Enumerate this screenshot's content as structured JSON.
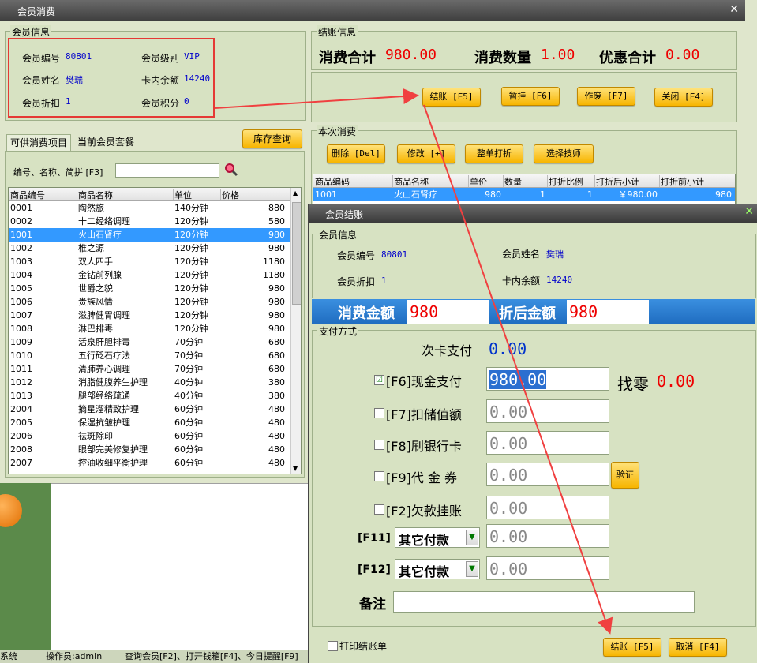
{
  "window": {
    "title": "会员消费"
  },
  "member_info": {
    "title": "会员信息",
    "no_label": "会员编号",
    "no": "80801",
    "level_label": "会员级别",
    "level": "VIP",
    "name_label": "会员姓名",
    "name": "樊瑞",
    "balance_label": "卡内余额",
    "balance": "14240",
    "discount_label": "会员折扣",
    "discount": "1",
    "points_label": "会员积分",
    "points": "0"
  },
  "checkout_info": {
    "title": "结账信息",
    "total_label": "消费合计",
    "total": "980.00",
    "qty_label": "消费数量",
    "qty": "1.00",
    "discount_label": "优惠合计",
    "discount": "0.00",
    "buttons": [
      "结账 [F5]",
      "暂挂 [F6]",
      "作废 [F7]",
      "关闭 [F4]"
    ]
  },
  "tabs": {
    "items": "可供消费项目",
    "packages": "当前会员套餐",
    "stock_button": "库存查询"
  },
  "search": {
    "label": "编号、名称、简拼 [F3]",
    "value": ""
  },
  "product_table": {
    "columns": [
      "商品编号",
      "商品名称",
      "单位",
      "价格"
    ],
    "selected_index": 2,
    "rows": [
      [
        "0001",
        "陶然旅",
        "140分钟",
        "880"
      ],
      [
        "0002",
        "十二经络调理",
        "120分钟",
        "580"
      ],
      [
        "1001",
        "火山石肾疗",
        "120分钟",
        "980"
      ],
      [
        "1002",
        "椎之源",
        "120分钟",
        "980"
      ],
      [
        "1003",
        "双人四手",
        "120分钟",
        "1180"
      ],
      [
        "1004",
        "金钻前列腺",
        "120分钟",
        "1180"
      ],
      [
        "1005",
        "世爵之貌",
        "120分钟",
        "980"
      ],
      [
        "1006",
        "贵族风情",
        "120分钟",
        "980"
      ],
      [
        "1007",
        "滋脾健胃调理",
        "120分钟",
        "980"
      ],
      [
        "1008",
        "淋巴排毒",
        "120分钟",
        "980"
      ],
      [
        "1009",
        "活泉肝胆排毒",
        "70分钟",
        "680"
      ],
      [
        "1010",
        "五行砭石疗法",
        "70分钟",
        "680"
      ],
      [
        "1011",
        "清肺养心调理",
        "70分钟",
        "680"
      ],
      [
        "1012",
        "消脂健腹养生护理",
        "40分钟",
        "380"
      ],
      [
        "1013",
        "腿部经络疏通",
        "40分钟",
        "380"
      ],
      [
        "2004",
        "摘星溜精致护理",
        "60分钟",
        "480"
      ],
      [
        "2005",
        "保湿抗皱护理",
        "60分钟",
        "480"
      ],
      [
        "2006",
        "祛斑除印",
        "60分钟",
        "480"
      ],
      [
        "2008",
        "眼部完美修复护理",
        "60分钟",
        "480"
      ],
      [
        "2007",
        "控油收细平衡护理",
        "60分钟",
        "480"
      ]
    ]
  },
  "current_consume": {
    "title": "本次消费",
    "buttons": [
      "删除 [Del]",
      "修改 [+]",
      "整单打折",
      "选择技师"
    ],
    "columns": [
      "商品编码",
      "商品名称",
      "单价",
      "数量",
      "打折比例",
      "打折后小计",
      "打折前小计"
    ],
    "rows": [
      [
        "1001",
        "火山石肾疗",
        "980",
        "1",
        "1",
        "￥980.00",
        "980"
      ]
    ]
  },
  "status_bar": {
    "left": "系统",
    "operator": "操作员:admin",
    "hint": "查询会员[F2]、打开钱箱[F4]、今日提醒[F9]"
  },
  "checkout_dialog": {
    "title": "会员结账",
    "info_title": "会员信息",
    "no_label": "会员编号",
    "no": "80801",
    "name_label": "会员姓名",
    "name": "樊瑞",
    "discount_label": "会员折扣",
    "discount": "1",
    "balance_label": "卡内余额",
    "balance": "14240",
    "amount_label": "消费金额",
    "amount": "980",
    "after_label": "折后金额",
    "after": "980",
    "pay_title": "支付方式",
    "times_card_label": "次卡支付",
    "times_card": "0.00",
    "cash_label": "[F6]现金支付",
    "cash": "980.00",
    "cash_checked": "☑",
    "change_label": "找零",
    "change": "0.00",
    "stored_label": "[F7]扣储值额",
    "stored": "0.00",
    "bank_label": "[F8]刷银行卡",
    "bank": "0.00",
    "voucher_label": "[F9]代 金 券",
    "voucher": "0.00",
    "verify_button": "验证",
    "credit_label": "[F2]欠款挂账",
    "credit": "0.00",
    "f11_label": "[F11]",
    "f11_select": "其它付款",
    "f11": "0.00",
    "f12_label": "[F12]",
    "f12_select": "其它付款",
    "f12": "0.00",
    "remark_label": "备注",
    "remark": "",
    "print_label": "打印结账单",
    "confirm_button": "结账 [F5]",
    "cancel_button": "取消 [F4]"
  },
  "colors": {
    "highlight_box": "#e53935",
    "arrow": "#f04040",
    "button": "#f7b500",
    "selection": "#3399ff"
  }
}
